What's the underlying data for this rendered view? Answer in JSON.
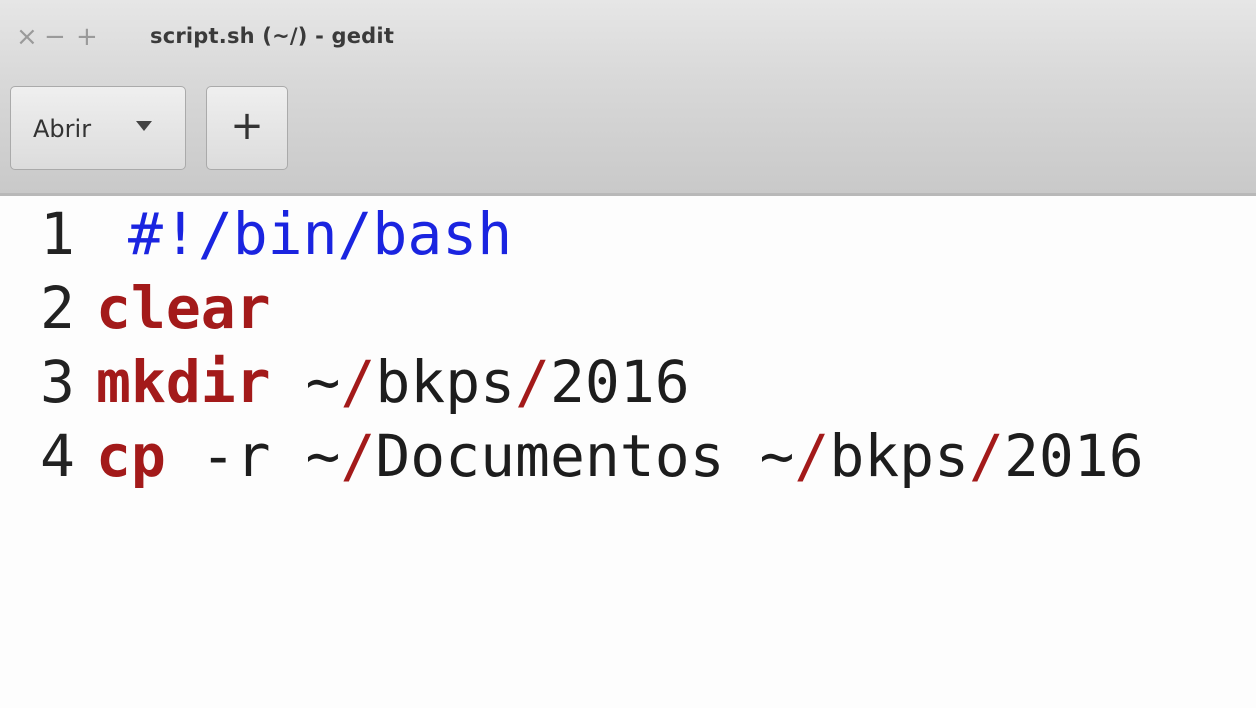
{
  "window": {
    "title": "script.sh (~/) - gedit",
    "controls": {
      "close": "×",
      "minimize": "−",
      "maximize": "+"
    }
  },
  "toolbar": {
    "open_label": "Abrir",
    "new_label": "+"
  },
  "editor": {
    "lines": [
      {
        "number": "1",
        "text": "#!/bin/bash"
      },
      {
        "number": "2",
        "cmd": "clear"
      },
      {
        "number": "3",
        "cmd": "mkdir",
        "rest": " ~",
        "slash": "/",
        "tail": "bkps",
        "slash2": "/",
        "tail2": "2016"
      },
      {
        "number": "4",
        "cmd": "cp",
        "rest": " -r ~",
        "slash": "/",
        "tail": "Documentos ~",
        "slash2": "/",
        "tail2": "bkps",
        "slash3": "/",
        "tail3": "2016"
      }
    ]
  },
  "colors": {
    "keyword": "#a31a1a",
    "shebang": "#1a24e0"
  }
}
